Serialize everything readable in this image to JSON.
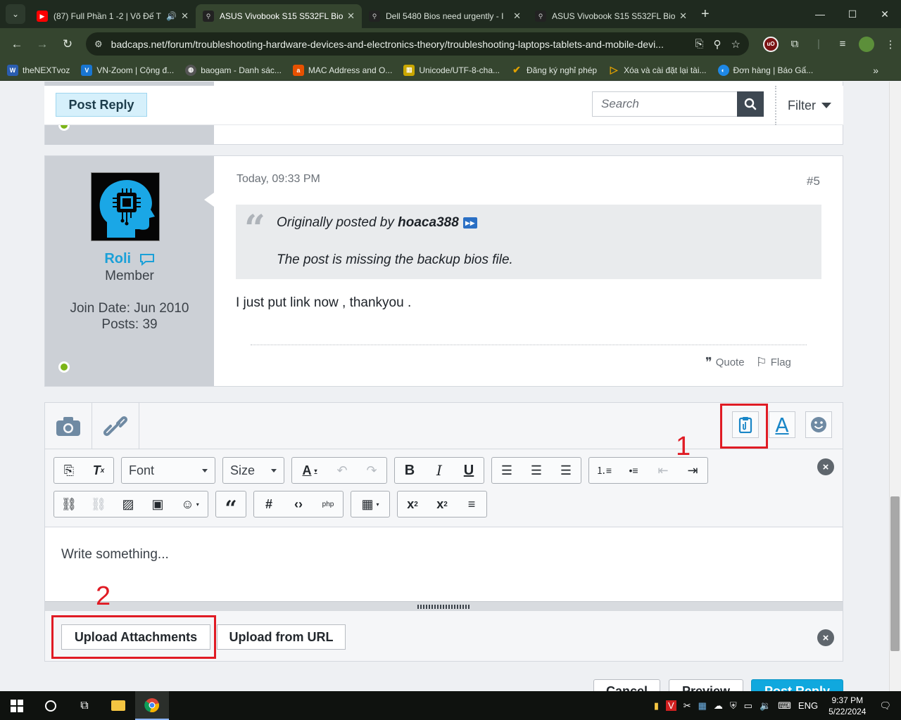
{
  "browser": {
    "tabs": [
      {
        "title": "(87) Full Phần 1 -2 | Võ Đế T",
        "active": false
      },
      {
        "title": "ASUS Vivobook S15 S532FL Bio",
        "active": true
      },
      {
        "title": "Dell 5480 Bios need urgently - I",
        "active": false
      },
      {
        "title": "ASUS Vivobook S15 S532FL Bio",
        "active": false
      }
    ],
    "url": "badcaps.net/forum/troubleshooting-hardware-devices-and-electronics-theory/troubleshooting-laptops-tablets-and-mobile-devi...",
    "bookmarks": [
      {
        "label": "theNEXTvoz",
        "color": "#2a5db0"
      },
      {
        "label": "VN-Zoom | Cộng đ...",
        "color": "#1976d2"
      },
      {
        "label": "baogam - Danh sác...",
        "color": "#555555"
      },
      {
        "label": "MAC Address and O...",
        "color": "#e65100"
      },
      {
        "label": "Unicode/UTF-8-cha...",
        "color": "#c9a700"
      },
      {
        "label": "Đăng ký nghỉ phép",
        "color": "#e0a000"
      },
      {
        "label": "Xóa và cài đặt lại tài...",
        "color": "#3a7bd5"
      },
      {
        "label": "Đơn hàng | Báo Gấ...",
        "color": "#1e88e5"
      }
    ]
  },
  "forum": {
    "post_reply_top": "Post Reply",
    "search_placeholder": "Search",
    "filter_label": "Filter"
  },
  "post": {
    "username": "Roli",
    "user_title": "Member",
    "join_date": "Join Date: Jun 2010",
    "posts": "Posts: 39",
    "date": "Today, 09:33 PM",
    "number": "#5",
    "quote_prefix": "Originally posted by ",
    "quote_author": "hoaca388",
    "quote_text": "The post is missing the backup bios file.",
    "body": "I just put link now , thankyou .",
    "quote_action": "Quote",
    "flag_action": "Flag"
  },
  "editor": {
    "font_label": "Font",
    "size_label": "Size",
    "placeholder": "Write something...",
    "upload_attachments": "Upload Attachments",
    "upload_url": "Upload from URL",
    "annotation_1": "1",
    "annotation_2": "2"
  },
  "bottom_buttons": {
    "cancel": "Cancel",
    "preview": "Preview",
    "post_reply": "Post Reply"
  },
  "taskbar": {
    "lang": "ENG",
    "time": "9:37 PM",
    "date": "5/22/2024"
  },
  "colors": {
    "accent": "#10a8de",
    "username": "#1aa0d8",
    "annotation": "#e01b24",
    "online": "#7cb518"
  }
}
